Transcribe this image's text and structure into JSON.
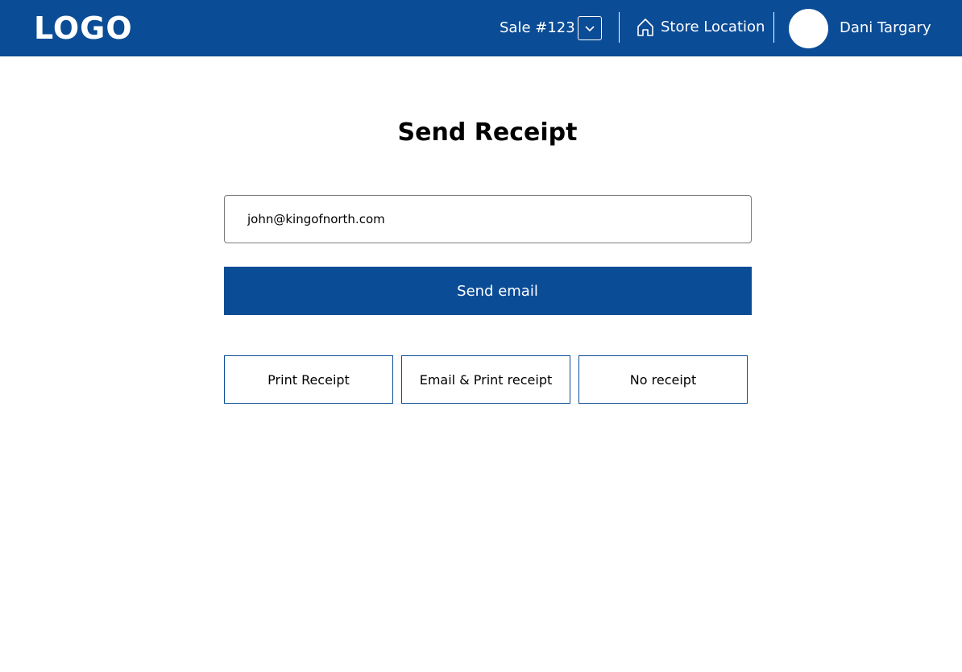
{
  "header": {
    "logo": "LOGO",
    "sale_label": "Sale #123",
    "dropdown_icon": "chevron-down-icon",
    "store_icon": "home-icon",
    "store_label": "Store Location",
    "user_name": "Dani Targary",
    "background_color": "#0b4c96"
  },
  "main": {
    "title": "Send Receipt",
    "email_value": "john@kingofnorth.com",
    "send_button_label": "Send email",
    "options": [
      {
        "label": "Print Receipt"
      },
      {
        "label": "Email & Print receipt"
      },
      {
        "label": "No receipt"
      }
    ],
    "accent_color": "#0b4c96"
  }
}
